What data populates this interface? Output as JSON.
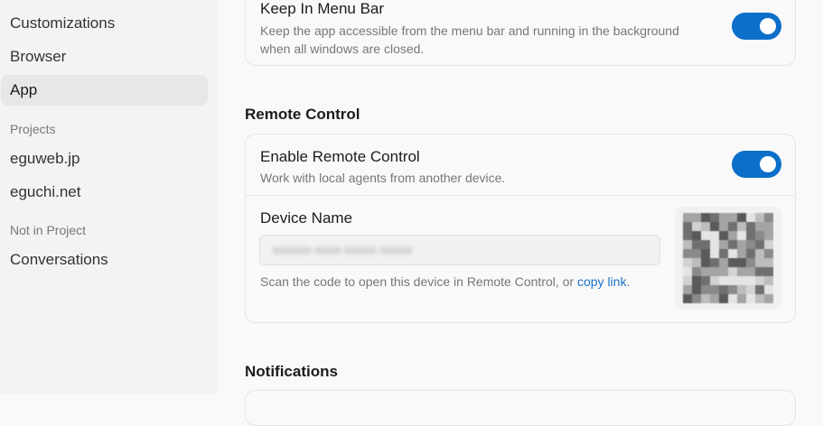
{
  "sidebar": {
    "items": [
      {
        "label": "Customizations"
      },
      {
        "label": "Browser"
      },
      {
        "label": "App"
      }
    ],
    "projects_heading": "Projects",
    "projects": [
      {
        "label": "eguweb.jp"
      },
      {
        "label": "eguchi.net"
      }
    ],
    "not_in_project_heading": "Not in Project",
    "other": [
      {
        "label": "Conversations"
      }
    ]
  },
  "keep_in_menu_bar": {
    "title": "Keep In Menu Bar",
    "description_line1": "Keep the app accessible from the menu bar and running in the background",
    "description_line2": "when all windows are closed.",
    "enabled": true
  },
  "remote_control": {
    "heading": "Remote Control",
    "enable_title": "Enable Remote Control",
    "enable_description": "Work with local agents from another device.",
    "enabled": true,
    "device_name_label": "Device Name",
    "device_name_value": "xxxxxx-xxxx-xxxxx-xxxxx",
    "scan_text": "Scan the code to open this device in Remote Control, or ",
    "copy_link": "copy link",
    "scan_text_end": "."
  },
  "notifications": {
    "heading": "Notifications"
  },
  "colors": {
    "toggle_on": "#0c6fc9",
    "link": "#1a73c9"
  }
}
